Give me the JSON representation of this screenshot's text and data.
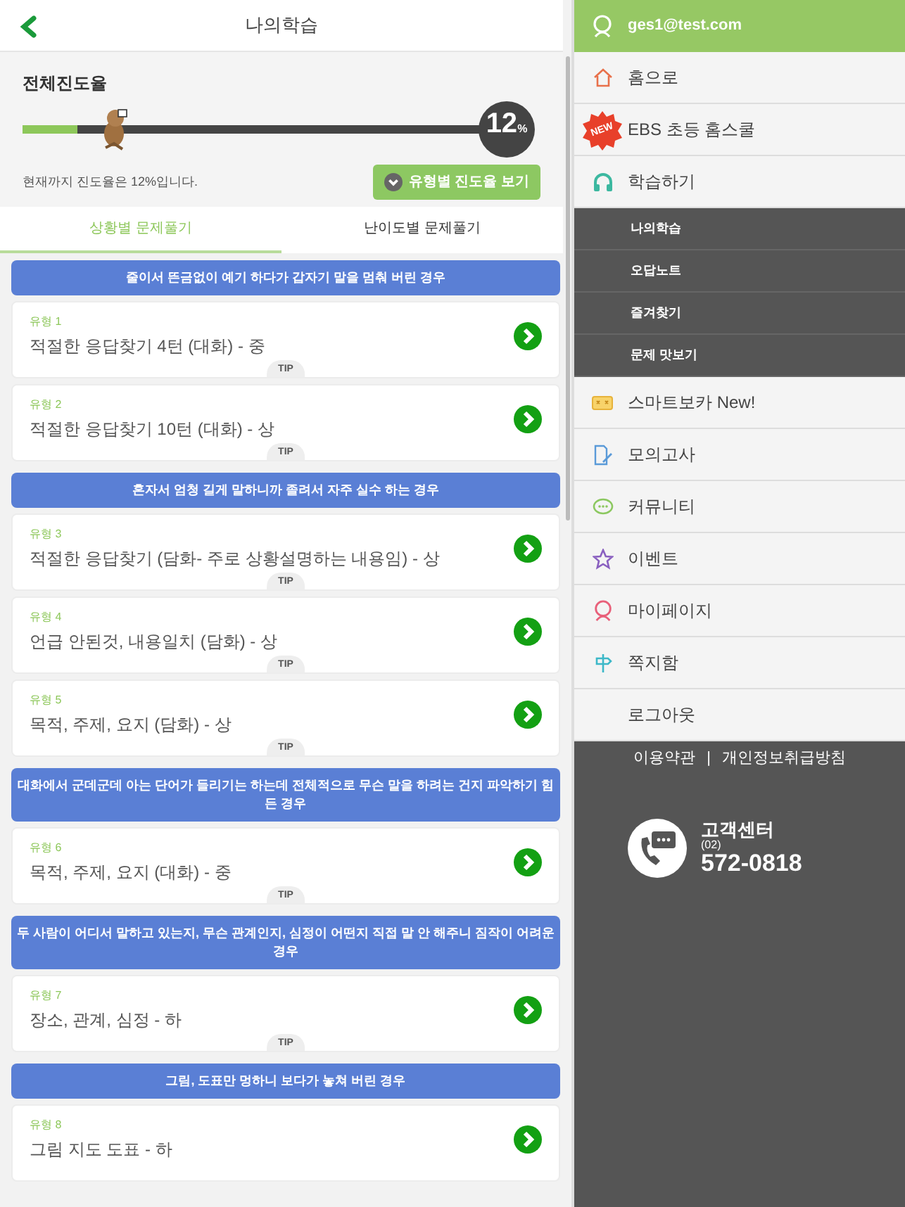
{
  "header": {
    "title": "나의학습"
  },
  "progress": {
    "label": "전체진도율",
    "level": 0.12,
    "percent": "12",
    "percent_unit": "%",
    "message": "현재까지 진도율은 12%입니다.",
    "button": "유형별 진도율 보기"
  },
  "tabs": [
    {
      "label": "상황별 문제풀기",
      "selected": true
    },
    {
      "label": "난이도별 문제풀기",
      "selected": false
    }
  ],
  "groups": [
    {
      "title": "줄이서 뜬금없이 예기 하다가 갑자기 말을 멈춰 버린 경우",
      "items": [
        {
          "type_label": "유형 1",
          "title": "적절한 응답찾기 4턴 (대화) - 중",
          "tip": "TIP"
        },
        {
          "type_label": "유형 2",
          "title": "적절한 응답찾기 10턴 (대화) - 상",
          "tip": "TIP"
        }
      ]
    },
    {
      "title": "혼자서 엄청 길게 말하니까 졸려서 자주 실수 하는 경우",
      "items": [
        {
          "type_label": "유형 3",
          "title": "적절한 응답찾기 (담화- 주로 상황설명하는 내용임) - 상",
          "tip": "TIP"
        },
        {
          "type_label": "유형 4",
          "title": "언급 안된것, 내용일치 (담화) - 상",
          "tip": "TIP"
        },
        {
          "type_label": "유형 5",
          "title": "목적, 주제, 요지 (담화) - 상",
          "tip": "TIP"
        }
      ]
    },
    {
      "title": "대화에서 군데군데 아는 단어가 들리기는 하는데 전체적으로 무슨 말을 하려는 건지 파악하기 힘든 경우",
      "items": [
        {
          "type_label": "유형 6",
          "title": "목적, 주제, 요지 (대화) - 중",
          "tip": "TIP"
        }
      ]
    },
    {
      "title": "두 사람이 어디서 말하고 있는지, 무슨 관계인지, 심정이 어떤지 직접 말 안 해주니 짐작이 어려운 경우",
      "items": [
        {
          "type_label": "유형 7",
          "title": "장소, 관계, 심정 - 하",
          "tip": "TIP"
        }
      ]
    },
    {
      "title": "그림, 도표만 멍하니 보다가 놓쳐 버린 경우",
      "items": [
        {
          "type_label": "유형 8",
          "title": "그림 지도 도표 - 하"
        }
      ]
    }
  ],
  "sidebar": {
    "user": "ges1@test.com",
    "items": [
      {
        "kind": "main",
        "label": "홈으로"
      },
      {
        "kind": "main",
        "label": "EBS 초등 홈스쿨",
        "badge": "NEW"
      },
      {
        "kind": "main",
        "label": "학습하기"
      },
      {
        "kind": "sub",
        "label": "나의학습"
      },
      {
        "kind": "sub",
        "label": "오답노트"
      },
      {
        "kind": "sub",
        "label": "즐겨찾기"
      },
      {
        "kind": "sub",
        "label": "문제 맛보기"
      },
      {
        "kind": "main",
        "label": "스마트보카 New!"
      },
      {
        "kind": "main",
        "label": "모의고사"
      },
      {
        "kind": "main",
        "label": "커뮤니티"
      },
      {
        "kind": "main",
        "label": "이벤트"
      },
      {
        "kind": "main",
        "label": "마이페이지"
      },
      {
        "kind": "main",
        "label": "쪽지함"
      },
      {
        "kind": "main",
        "label": "로그아웃"
      }
    ],
    "footer_links": [
      "이용약관",
      "개인정보취급방침"
    ],
    "footer_separator": "|",
    "customer_center": {
      "title": "고객센터",
      "area_code": "(02)",
      "number": "572-0818"
    }
  }
}
